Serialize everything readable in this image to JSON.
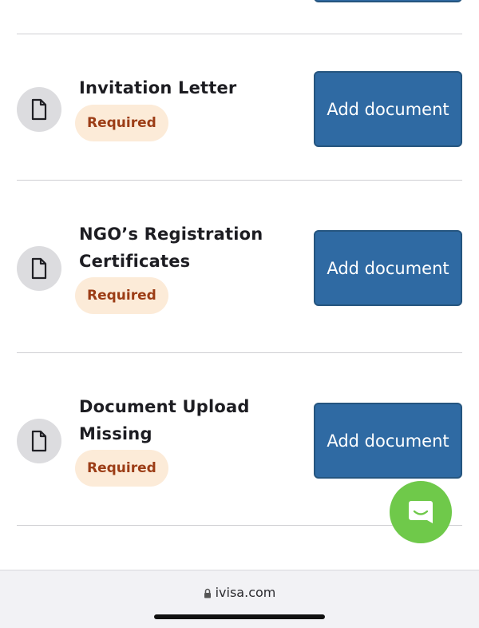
{
  "documents": [
    {
      "title": "Invitation Letter",
      "status": "Required",
      "button_label": "Add document"
    },
    {
      "title": "NGO’s Registration Certificates",
      "status": "Required",
      "button_label": "Add document"
    },
    {
      "title": "Document Upload Missing",
      "status": "Required",
      "button_label": "Add document"
    }
  ],
  "browser": {
    "url": "ivisa.com"
  },
  "colors": {
    "button": "#2f6aa3",
    "badge_bg": "#fcebd8",
    "badge_text": "#9c3d16",
    "chat_fab": "#6fc94a"
  }
}
